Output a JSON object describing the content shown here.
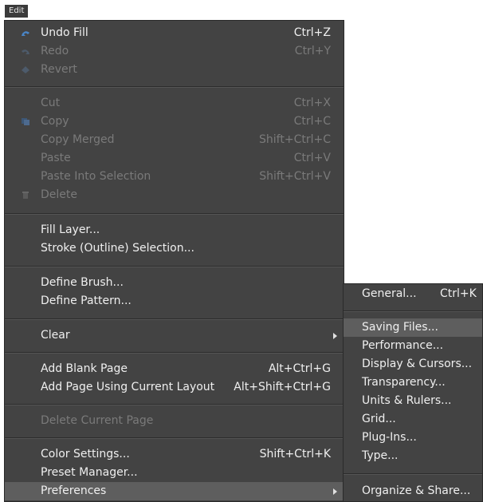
{
  "menubar": {
    "edit_label": "Edit"
  },
  "menu": {
    "undo": {
      "label": "Undo Fill",
      "shortcut": "Ctrl+Z"
    },
    "redo": {
      "label": "Redo",
      "shortcut": "Ctrl+Y"
    },
    "revert": {
      "label": "Revert"
    },
    "cut": {
      "label": "Cut",
      "shortcut": "Ctrl+X"
    },
    "copy": {
      "label": "Copy",
      "shortcut": "Ctrl+C"
    },
    "copy_merged": {
      "label": "Copy Merged",
      "shortcut": "Shift+Ctrl+C"
    },
    "paste": {
      "label": "Paste",
      "shortcut": "Ctrl+V"
    },
    "paste_into_selection": {
      "label": "Paste Into Selection",
      "shortcut": "Shift+Ctrl+V"
    },
    "delete": {
      "label": "Delete"
    },
    "fill_layer": {
      "label": "Fill Layer..."
    },
    "stroke_selection": {
      "label": "Stroke (Outline) Selection..."
    },
    "define_brush": {
      "label": "Define Brush..."
    },
    "define_pattern": {
      "label": "Define Pattern..."
    },
    "clear": {
      "label": "Clear"
    },
    "add_blank_page": {
      "label": "Add Blank Page",
      "shortcut": "Alt+Ctrl+G"
    },
    "add_page_layout": {
      "label": "Add Page Using Current Layout",
      "shortcut": "Alt+Shift+Ctrl+G"
    },
    "delete_current_page": {
      "label": "Delete Current Page"
    },
    "color_settings": {
      "label": "Color Settings...",
      "shortcut": "Shift+Ctrl+K"
    },
    "preset_manager": {
      "label": "Preset Manager..."
    },
    "preferences": {
      "label": "Preferences"
    }
  },
  "submenu": {
    "general": {
      "label": "General...",
      "shortcut": "Ctrl+K"
    },
    "saving_files": {
      "label": "Saving Files..."
    },
    "performance": {
      "label": "Performance..."
    },
    "display_cursors": {
      "label": "Display & Cursors..."
    },
    "transparency": {
      "label": "Transparency..."
    },
    "units_rulers": {
      "label": "Units & Rulers..."
    },
    "grid": {
      "label": "Grid..."
    },
    "plugins": {
      "label": "Plug-Ins..."
    },
    "type": {
      "label": "Type..."
    },
    "organize_share": {
      "label": "Organize & Share..."
    }
  },
  "colors": {
    "menu_bg": "#434343",
    "highlight": "#5e5e5e",
    "text": "#efefef",
    "disabled_text": "#7a7a7a"
  }
}
